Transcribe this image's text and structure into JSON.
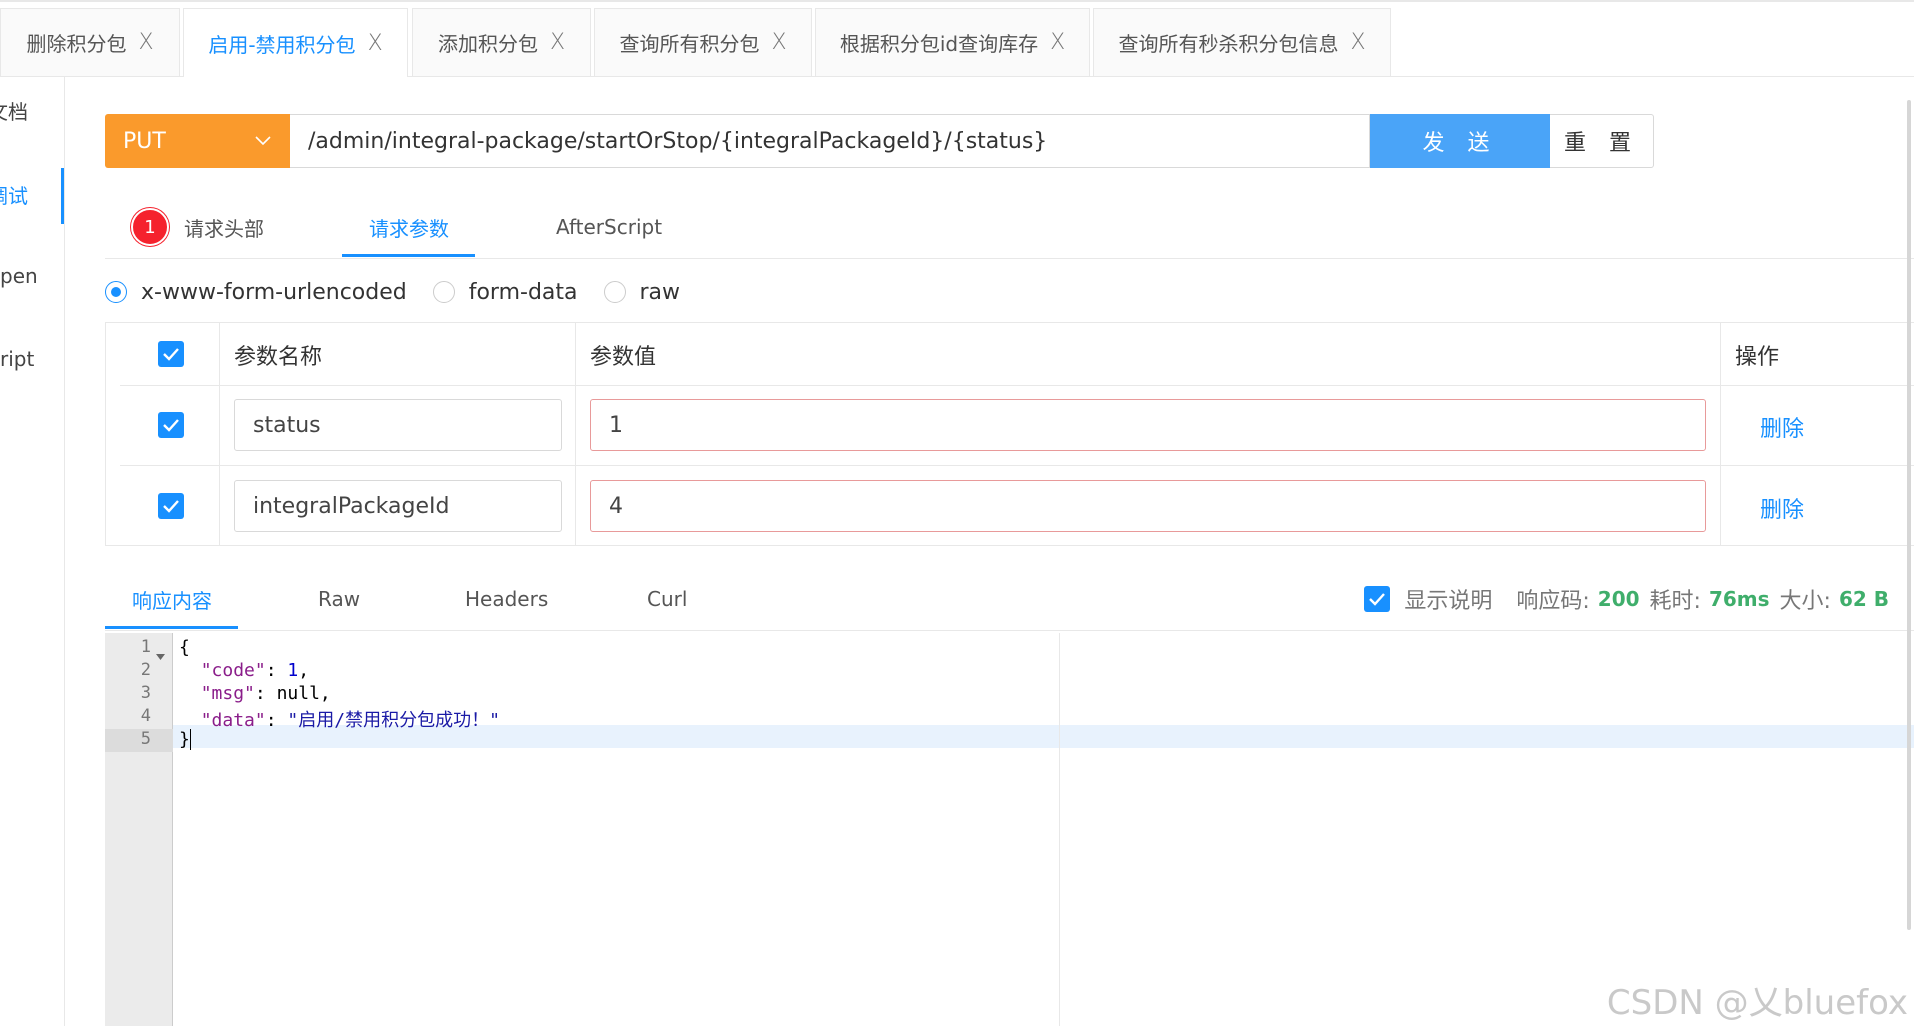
{
  "tabs": [
    {
      "label": "删除积分包",
      "close": "X"
    },
    {
      "label": "启用-禁用积分包",
      "close": "X",
      "active": true
    },
    {
      "label": "添加积分包",
      "close": "X"
    },
    {
      "label": "查询所有积分包",
      "close": "X"
    },
    {
      "label": "根据积分包id查询库存",
      "close": "X"
    },
    {
      "label": "查询所有秒杀积分包信息",
      "close": "X"
    }
  ],
  "sidenav": {
    "items": [
      {
        "label": "文档"
      },
      {
        "label": "调试",
        "active": true
      },
      {
        "label": "pen"
      },
      {
        "label": "ript"
      }
    ]
  },
  "request": {
    "method": "PUT",
    "method_icon": "chevron-down-icon",
    "url": "/admin/integral-package/startOrStop/{integralPackageId}/{status}",
    "send_label": "发 送",
    "reset_label": "重 置"
  },
  "subtabs": {
    "headers_badge": "1",
    "headers_label": "请求头部",
    "params_label": "请求参数",
    "afterscript_label": "AfterScript"
  },
  "body_types": {
    "options": [
      "x-www-form-urlencoded",
      "form-data",
      "raw"
    ],
    "selected": "x-www-form-urlencoded"
  },
  "params_table": {
    "headers": {
      "name": "参数名称",
      "value": "参数值",
      "action": "操作"
    },
    "rows": [
      {
        "checked": true,
        "name": "status",
        "value": "1",
        "action": "删除"
      },
      {
        "checked": true,
        "name": "integralPackageId",
        "value": "4",
        "action": "删除"
      }
    ]
  },
  "response": {
    "tabs": [
      "响应内容",
      "Raw",
      "Headers",
      "Curl"
    ],
    "show_desc_label": "显示说明",
    "status_label": "响应码:",
    "status_value": "200",
    "time_label": "耗时:",
    "time_value": "76ms",
    "size_label": "大小:",
    "size_value": "62 B",
    "line_numbers": [
      "1",
      "2",
      "3",
      "4",
      "5"
    ],
    "json": {
      "open": "{",
      "code_key": "\"code\"",
      "code_val": "1",
      "msg_key": "\"msg\"",
      "msg_val": "null",
      "data_key": "\"data\"",
      "data_val": "\"启用/禁用积分包成功！\"",
      "close": "}"
    }
  },
  "watermark": "CSDN @乂bluefox",
  "colors": {
    "accent": "#1890ff",
    "method_bg": "#fa9a2c",
    "send_bg": "#4aa4f8",
    "badge": "#f5222d",
    "status_green": "#3fae6b"
  }
}
